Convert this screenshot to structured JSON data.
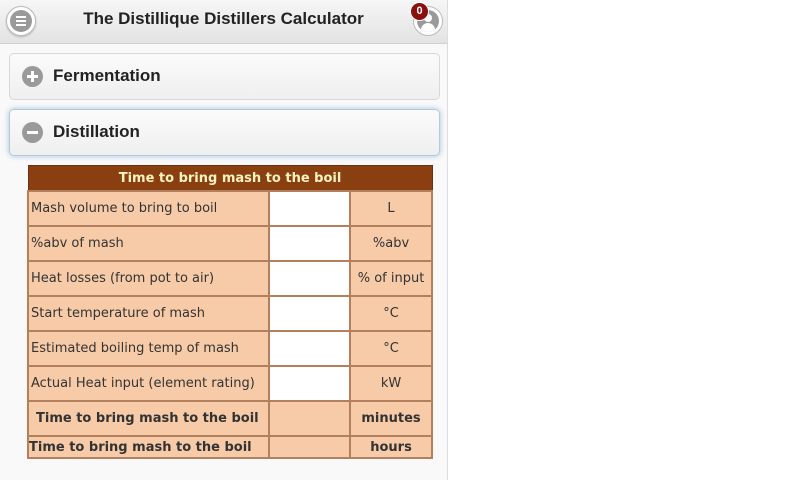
{
  "header": {
    "title": "The Distillique Distillers Calculator",
    "notification_count": "0"
  },
  "sections": [
    {
      "label": "Fermentation",
      "expanded": false,
      "icon": "plus-icon"
    },
    {
      "label": "Distillation",
      "expanded": true,
      "icon": "minus-icon"
    }
  ],
  "calculator": {
    "title": "Time to bring mash to the boil",
    "rows": [
      {
        "label": "Mash volume to bring to boil",
        "value": "",
        "unit": "L"
      },
      {
        "label": "%abv of mash",
        "value": "",
        "unit": "%abv"
      },
      {
        "label": "Heat losses (from pot to air)",
        "value": "",
        "unit": "% of input"
      },
      {
        "label": "Start temperature of mash",
        "value": "",
        "unit": "°C"
      },
      {
        "label": "Estimated boiling temp of mash",
        "value": "",
        "unit": "°C"
      },
      {
        "label": "Actual Heat input (element rating)",
        "value": "",
        "unit": "kW"
      }
    ],
    "results": [
      {
        "label": "Time to bring mash to the boil",
        "value": "",
        "unit": "minutes"
      },
      {
        "label": "Time to bring mash to the boil",
        "value": "",
        "unit": "hours"
      }
    ]
  },
  "colors": {
    "table_header": "#8a3f10",
    "table_header_text": "#fff3c0",
    "cell_fill": "#f7cba8",
    "badge": "#8b1010"
  }
}
